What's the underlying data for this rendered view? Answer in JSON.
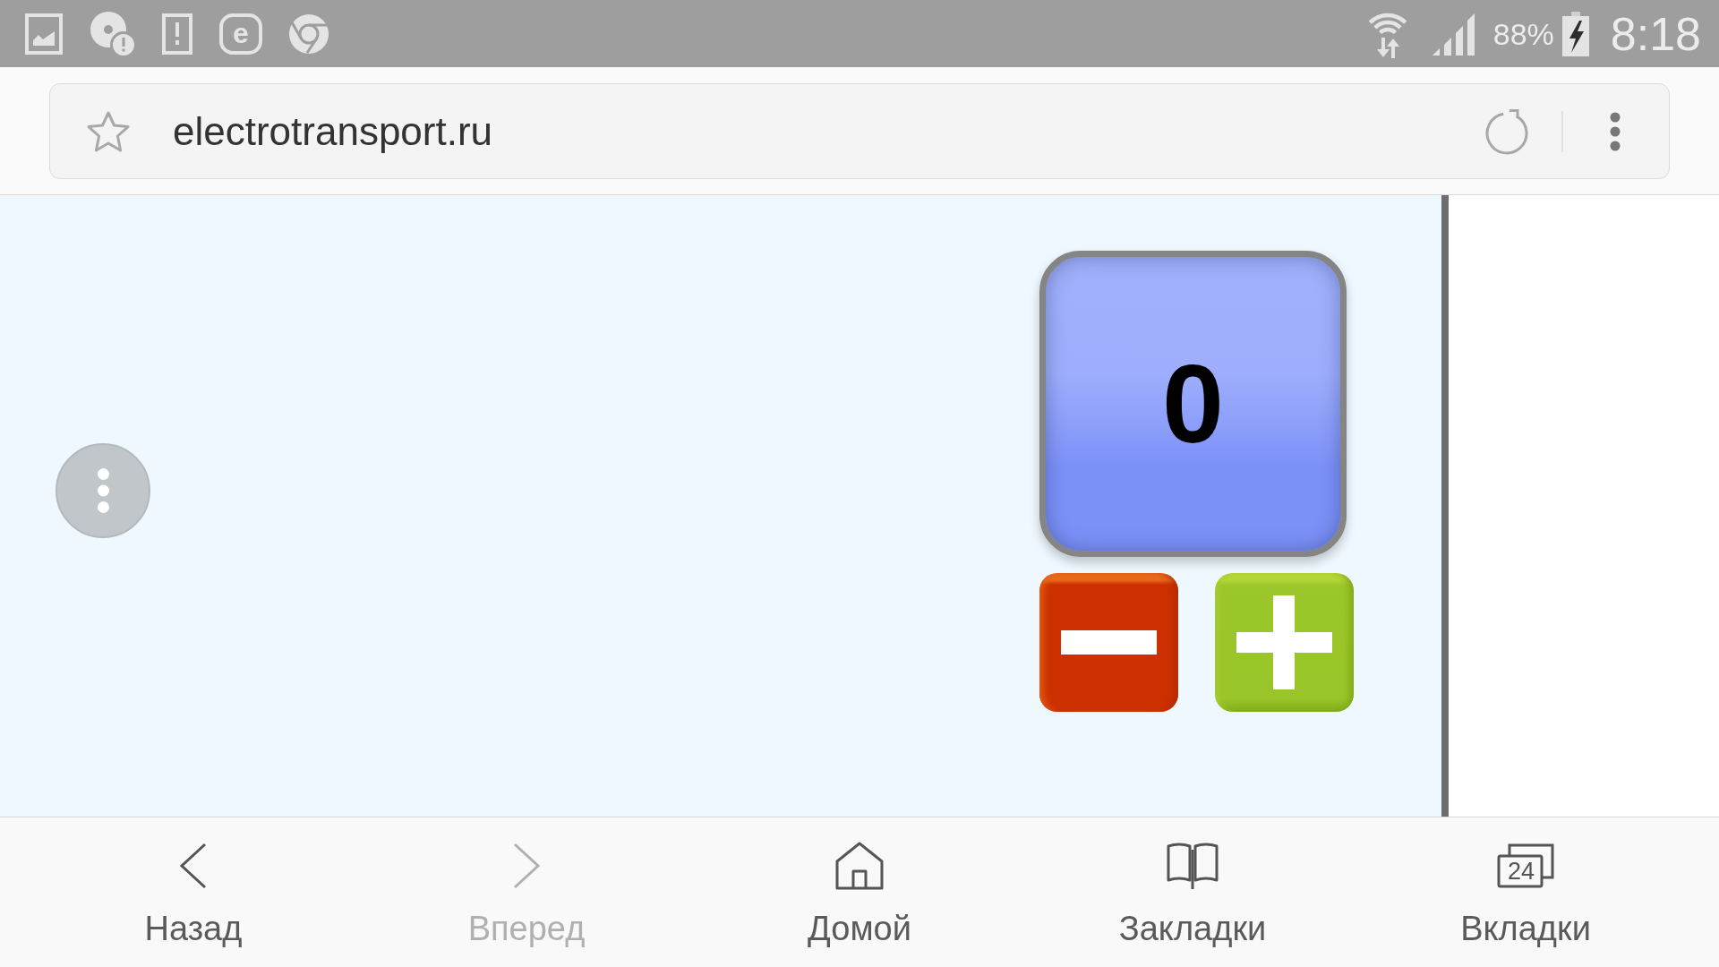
{
  "status_bar": {
    "app_icon_letter": "e",
    "battery": "88%",
    "time": "8:18"
  },
  "address_bar": {
    "url": "electrotransport.ru"
  },
  "counter": {
    "value": "0"
  },
  "bottom_nav": [
    {
      "label": "Назад",
      "disabled": false
    },
    {
      "label": "Вперед",
      "disabled": true
    },
    {
      "label": "Домой",
      "disabled": false
    },
    {
      "label": "Закладки",
      "disabled": false
    },
    {
      "label": "Вкладки",
      "disabled": false,
      "count": "24"
    }
  ]
}
